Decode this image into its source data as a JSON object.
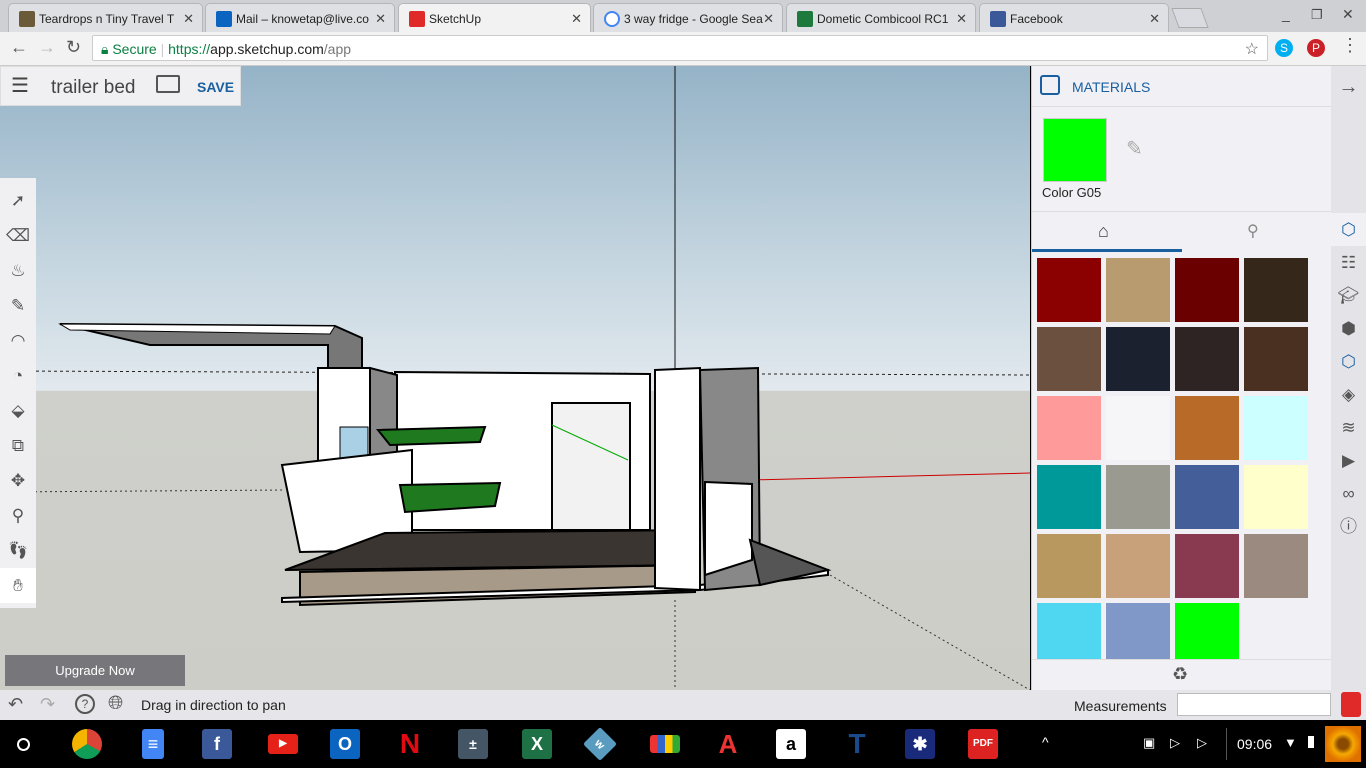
{
  "browser": {
    "tabs": [
      {
        "title": "Teardrops n Tiny Travel T",
        "icon": "photo-icon",
        "color": "#6b5a3a"
      },
      {
        "title": "Mail – knowetap@live.co",
        "icon": "outlook-icon",
        "color": "#0a64c0"
      },
      {
        "title": "SketchUp",
        "icon": "sketchup-icon",
        "color": "#e02a2a",
        "active": true
      },
      {
        "title": "3 way fridge - Google Sea",
        "icon": "google-icon",
        "color": "#4285f4"
      },
      {
        "title": "Dometic Combicool RC1",
        "icon": "dometic-icon",
        "color": "#1e7a3c"
      },
      {
        "title": "Facebook",
        "icon": "facebook-icon",
        "color": "#3b5998"
      }
    ],
    "secure_label": "Secure",
    "url_scheme": "https://",
    "url_host": "app.sketchup.com",
    "url_path": "/app"
  },
  "app": {
    "menu_icon": "hamburger-icon",
    "file_name": "trailer bed",
    "save_label": "SAVE",
    "upgrade_label": "Upgrade Now",
    "tools": [
      "select-icon",
      "eraser-icon",
      "paint-bucket-icon",
      "pencil-icon",
      "arc-icon",
      "tape-measure-icon",
      "push-pull-icon",
      "offset-icon",
      "move-icon",
      "orbit-icon",
      "walk-icon",
      "look-around-icon"
    ]
  },
  "materials": {
    "title": "MATERIALS",
    "current_name": "Color G05",
    "current_color": "#00ff00",
    "tabs": [
      "home-icon",
      "search-materials-icon"
    ],
    "swatches": [
      "#8b0000",
      "#b89b6e",
      "#6b0000",
      "#35271a",
      "#6b5040",
      "#1c2130",
      "#2e2424",
      "#4a3020",
      "#ff9a9a",
      "#f6f6f8",
      "#b86a28",
      "#ccffff",
      "#009999",
      "#9a9a90",
      "#445e9a",
      "#ffffcc",
      "#b8985e",
      "#c8a07a",
      "#8a3a50",
      "#9a8a80",
      "#4fd6f0",
      "#7f98c8",
      "#00ff00"
    ],
    "footer_icon": "recycle-icon"
  },
  "right_toolbar": [
    "materials-icon",
    "outliner-icon",
    "instructor-icon",
    "components-icon",
    "materials-icon",
    "styles-icon",
    "layers-icon",
    "scenes-icon",
    "display-icon",
    "model-info-icon"
  ],
  "status": {
    "hint": "Drag in direction to pan",
    "measurements_label": "Measurements",
    "measurements_value": ""
  },
  "taskbar": {
    "time": "09:06",
    "apps": [
      "chrome",
      "docs",
      "facebook",
      "youtube",
      "outlook",
      "netflix",
      "calculator",
      "excel",
      "w",
      "palette",
      "adobe",
      "amazon",
      "t",
      "x",
      "pdf"
    ]
  }
}
